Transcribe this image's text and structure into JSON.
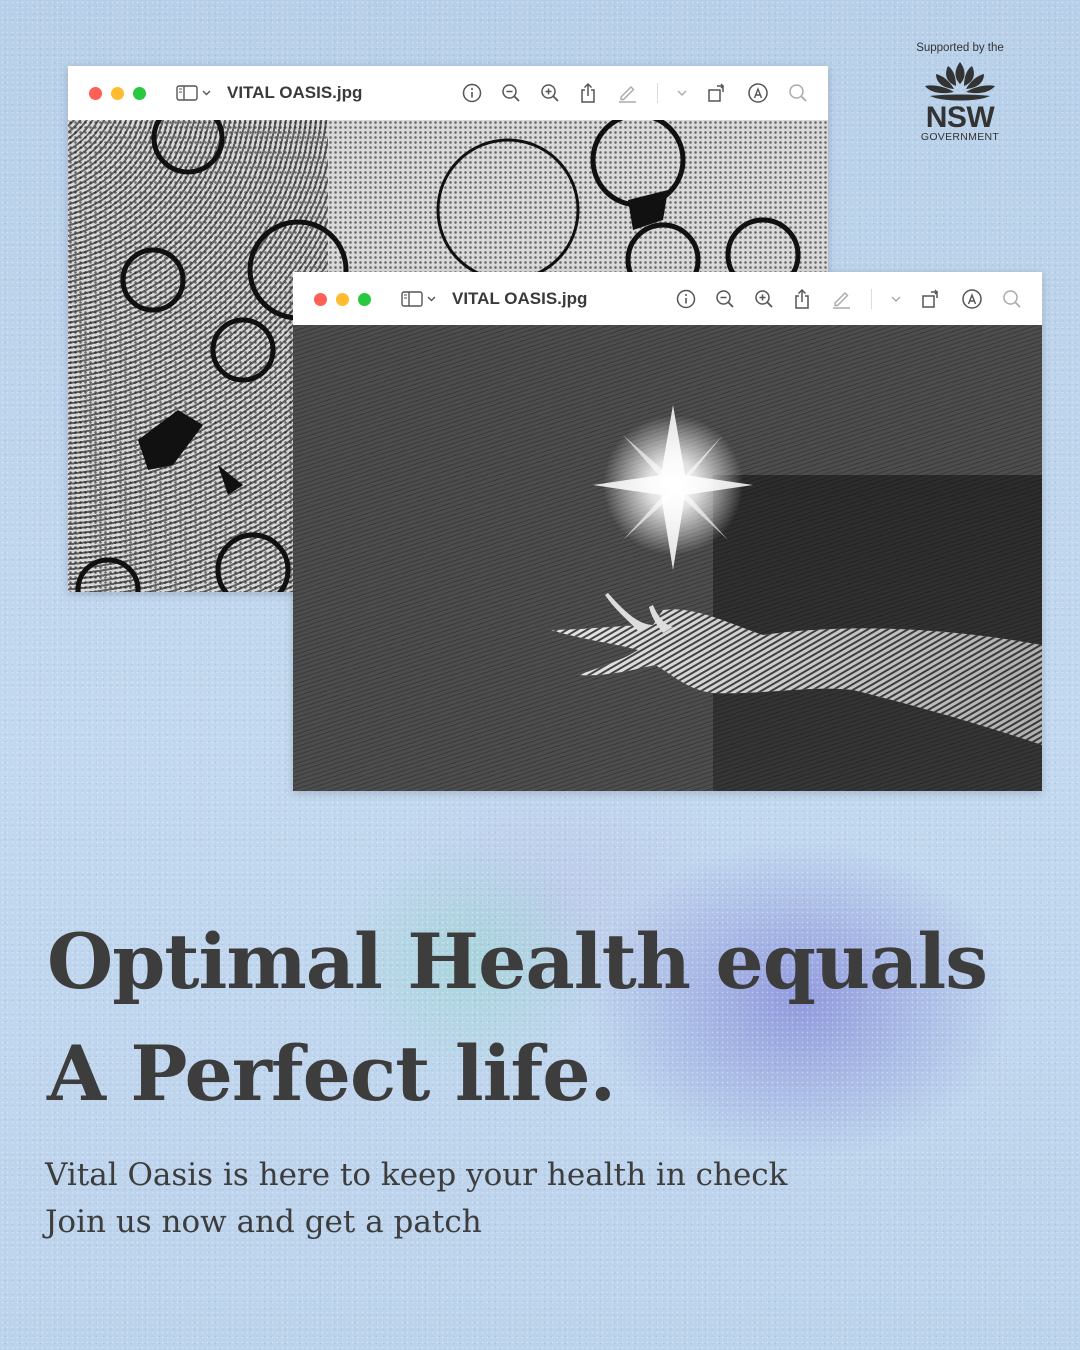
{
  "logo": {
    "supported_by": "Supported by the",
    "wordmark": "NSW",
    "government": "GOVERNMENT"
  },
  "windows": [
    {
      "title": "VITAL OASIS.jpg",
      "traffic_lights": {
        "close": "#fe5f57",
        "minimize": "#febc2e",
        "zoom": "#28c840"
      },
      "toolbar_icons": [
        "sidebar-icon",
        "info-icon",
        "zoom-out-icon",
        "zoom-in-icon",
        "share-icon",
        "markup-pen-icon",
        "rotate-icon",
        "markup-icon",
        "search-icon"
      ]
    },
    {
      "title": "VITAL OASIS.jpg",
      "traffic_lights": {
        "close": "#fe5f57",
        "minimize": "#febc2e",
        "zoom": "#28c840"
      },
      "toolbar_icons": [
        "sidebar-icon",
        "info-icon",
        "zoom-out-icon",
        "zoom-in-icon",
        "share-icon",
        "markup-pen-icon",
        "rotate-icon",
        "markup-icon",
        "search-icon"
      ]
    }
  ],
  "headline": {
    "line1": "Optimal Health equals",
    "line2": "A Perfect life."
  },
  "subtext": {
    "line1": "Vital Oasis is here to keep your health in check",
    "line2": "Join us now and get a patch"
  },
  "colors": {
    "background": "#bcd4ec",
    "text": "#3d3d3d",
    "glow_purple": "#8287d7",
    "glow_teal": "#96d7cd"
  }
}
